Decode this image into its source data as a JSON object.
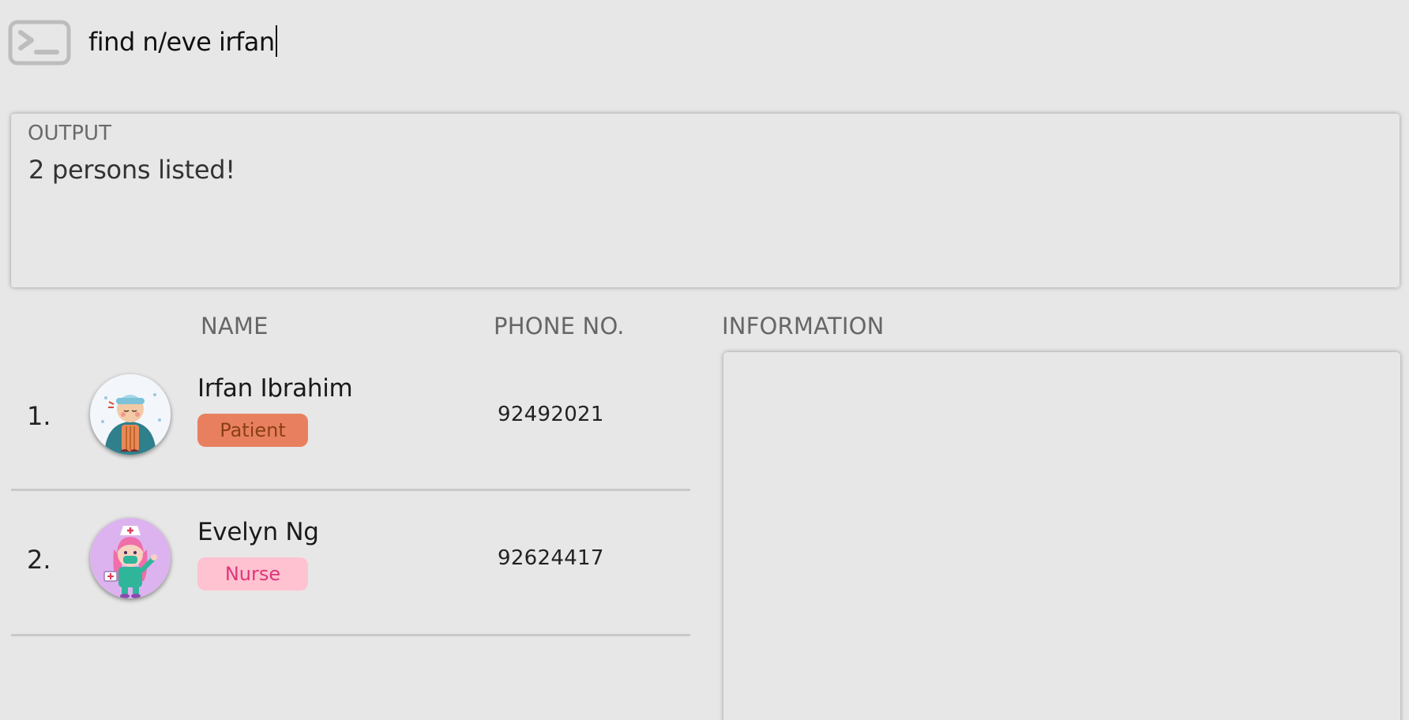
{
  "command": {
    "icon": "terminal-icon",
    "value": "find n/eve irfan"
  },
  "output": {
    "heading": "OUTPUT",
    "message": "2 persons listed!"
  },
  "columns": {
    "name": "NAME",
    "phone": "PHONE NO.",
    "information": "INFORMATION"
  },
  "persons": [
    {
      "index": "1.",
      "name": "Irfan Ibrahim",
      "role": "Patient",
      "phone": "92492021",
      "avatar": "patient-avatar-icon",
      "tag_bg": "#e8805f",
      "tag_fg": "#8a3f16"
    },
    {
      "index": "2.",
      "name": "Evelyn Ng",
      "role": "Nurse",
      "phone": "92624417",
      "avatar": "nurse-avatar-icon",
      "tag_bg": "#ffc2d0",
      "tag_fg": "#e0357a"
    }
  ]
}
